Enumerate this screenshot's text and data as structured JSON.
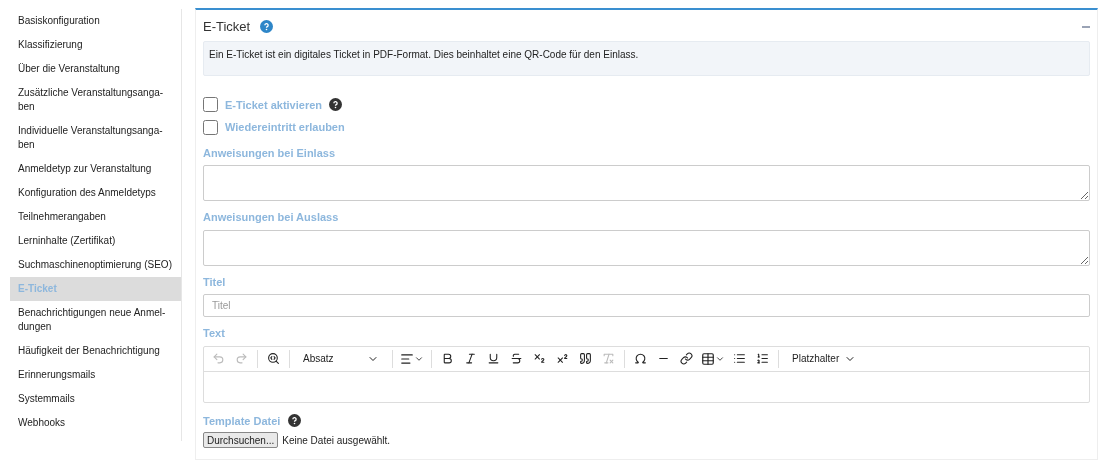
{
  "sidebar": {
    "items": [
      {
        "label": "Basiskonfiguration",
        "selected": false
      },
      {
        "label": "Klassifizierung",
        "selected": false
      },
      {
        "label": "Über die Veranstaltung",
        "selected": false
      },
      {
        "label": "Zusätzliche Veranstaltungsanga-\nben",
        "selected": false
      },
      {
        "label": "Individuelle Veranstaltungsanga-\nben",
        "selected": false
      },
      {
        "label": "Anmeldetyp zur Veranstaltung",
        "selected": false
      },
      {
        "label": "Konfiguration des Anmeldetyps",
        "selected": false
      },
      {
        "label": "Teilnehmerangaben",
        "selected": false
      },
      {
        "label": "Lerninhalte (Zertifikat)",
        "selected": false
      },
      {
        "label": "Suchmaschinenoptimierung (SEO)",
        "selected": false
      },
      {
        "label": "E-Ticket",
        "selected": true
      },
      {
        "label": "Benachrichtigungen neue Anmel-\ndungen",
        "selected": false
      },
      {
        "label": "Häufigkeit der Benachrichtigung",
        "selected": false
      },
      {
        "label": "Erinnerungsmails",
        "selected": false
      },
      {
        "label": "Systemmails",
        "selected": false
      },
      {
        "label": "Webhooks",
        "selected": false
      }
    ]
  },
  "panel": {
    "title": "E-Ticket",
    "expanded": true,
    "info": "Ein E-Ticket ist ein digitales Ticket in PDF-Format. Dies beinhaltet eine QR-Code für den Einlass.",
    "checkboxes": [
      {
        "label": "E-Ticket aktivieren",
        "checked": false,
        "help": true
      },
      {
        "label": "Wiedereintritt erlauben",
        "checked": false,
        "help": false
      }
    ],
    "fields": [
      {
        "kind": "textarea",
        "label": "Anweisungen bei Einlass"
      },
      {
        "kind": "textarea",
        "label": "Anweisungen bei Auslass"
      },
      {
        "kind": "input",
        "label": "Titel",
        "placeholder": "Titel"
      },
      {
        "kind": "editor",
        "label": "Text",
        "block_format": "Absatz",
        "placeholder_menu": "Platzhalter",
        "toolbar": [
          {
            "kind": "undo",
            "disabled": true
          },
          {
            "kind": "redo",
            "disabled": true
          },
          {
            "kind": "sep"
          },
          {
            "kind": "find",
            "disabled": false
          },
          {
            "kind": "sep"
          },
          {
            "kind": "format"
          },
          {
            "kind": "sep"
          },
          {
            "kind": "align",
            "disabled": false
          },
          {
            "kind": "sep"
          },
          {
            "kind": "bold",
            "disabled": false
          },
          {
            "kind": "italic",
            "disabled": false
          },
          {
            "kind": "underline",
            "disabled": false
          },
          {
            "kind": "strike",
            "disabled": false
          },
          {
            "kind": "sub",
            "disabled": false
          },
          {
            "kind": "sup",
            "disabled": false
          },
          {
            "kind": "quote",
            "disabled": false
          },
          {
            "kind": "clear",
            "disabled": true
          },
          {
            "kind": "sep"
          },
          {
            "kind": "omega",
            "disabled": false
          },
          {
            "kind": "hr",
            "disabled": false
          },
          {
            "kind": "link",
            "disabled": false
          },
          {
            "kind": "table",
            "disabled": false
          },
          {
            "kind": "ul",
            "disabled": false
          },
          {
            "kind": "ol",
            "disabled": false
          },
          {
            "kind": "sep"
          },
          {
            "kind": "placeholder"
          }
        ]
      },
      {
        "kind": "file",
        "label": "Template Datei",
        "button": "Durchsuchen...",
        "status": "Keine Datei ausgewählt."
      }
    ]
  }
}
